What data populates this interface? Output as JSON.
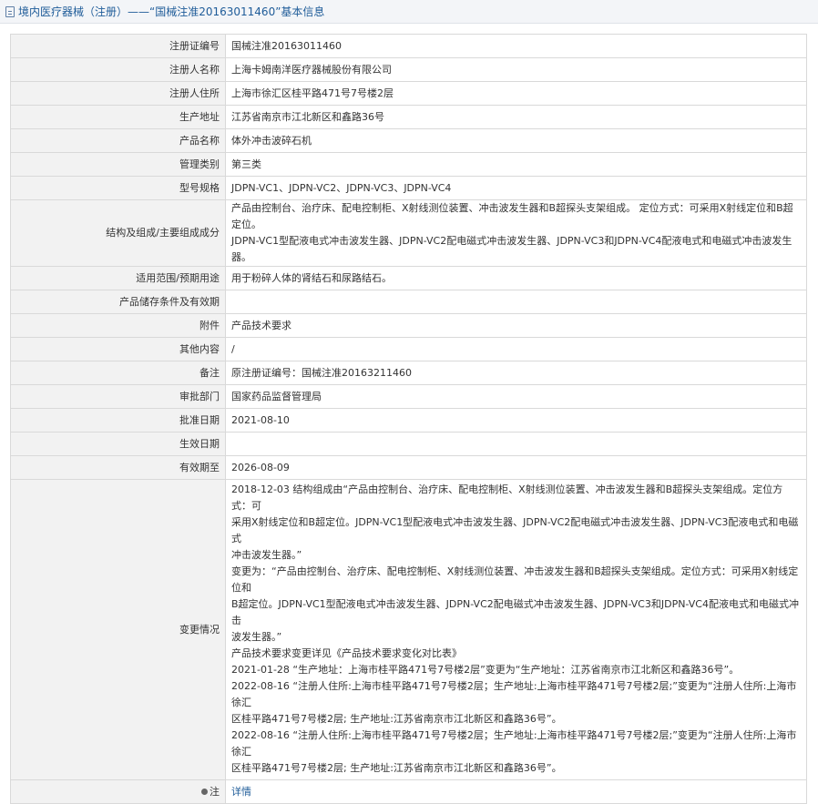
{
  "header": {
    "title": "境内医疗器械（注册）——“国械注准20163011460”基本信息",
    "icon": "document-icon"
  },
  "rows": [
    {
      "label": "注册证编号",
      "value": "国械注准20163011460"
    },
    {
      "label": "注册人名称",
      "value": "上海卡姆南洋医疗器械股份有限公司"
    },
    {
      "label": "注册人住所",
      "value": "上海市徐汇区桂平路471号7号楼2层"
    },
    {
      "label": "生产地址",
      "value": "江苏省南京市江北新区和鑫路36号"
    },
    {
      "label": "产品名称",
      "value": "体外冲击波碎石机"
    },
    {
      "label": "管理类别",
      "value": "第三类"
    },
    {
      "label": "型号规格",
      "value": "JDPN-VC1、JDPN-VC2、JDPN-VC3、JDPN-VC4"
    },
    {
      "label": "结构及组成/主要组成成分",
      "lines": [
        "产品由控制台、治疗床、配电控制柜、X射线测位装置、冲击波发生器和B超探头支架组成。 定位方式：可采用X射线定位和B超定位。",
        "JDPN-VC1型配液电式冲击波发生器、JDPN-VC2配电磁式冲击波发生器、JDPN-VC3和JDPN-VC4配液电式和电磁式冲击波发生器。"
      ]
    },
    {
      "label": "适用范围/预期用途",
      "value": "用于粉碎人体的肾结石和尿路结石。"
    },
    {
      "label": "产品储存条件及有效期",
      "value": ""
    },
    {
      "label": "附件",
      "value": "产品技术要求"
    },
    {
      "label": "其他内容",
      "value": "/"
    },
    {
      "label": "备注",
      "value": "原注册证编号：国械注准20163211460"
    },
    {
      "label": "审批部门",
      "value": "国家药品监督管理局"
    },
    {
      "label": "批准日期",
      "value": "2021-08-10"
    },
    {
      "label": "生效日期",
      "value": ""
    },
    {
      "label": "有效期至",
      "value": "2026-08-09"
    }
  ],
  "changes": {
    "label": "变更情况",
    "lines": [
      "2018-12-03 结构组成由“产品由控制台、治疗床、配电控制柜、X射线测位装置、冲击波发生器和B超探头支架组成。定位方式：可",
      "采用X射线定位和B超定位。JDPN-VC1型配液电式冲击波发生器、JDPN-VC2配电磁式冲击波发生器、JDPN-VC3配液电式和电磁式",
      "冲击波发生器。”",
      "变更为：“产品由控制台、治疗床、配电控制柜、X射线测位装置、冲击波发生器和B超探头支架组成。定位方式：可采用X射线定位和",
      "B超定位。JDPN-VC1型配液电式冲击波发生器、JDPN-VC2配电磁式冲击波发生器、JDPN-VC3和JDPN-VC4配液电式和电磁式冲击",
      "波发生器。”",
      "产品技术要求变更详见《产品技术要求变化对比表》",
      "2021-01-28 “生产地址：上海市桂平路471号7号楼2层”变更为“生产地址：江苏省南京市江北新区和鑫路36号”。",
      "2022-08-16 “注册人住所:上海市桂平路471号7号楼2层；生产地址:上海市桂平路471号7号楼2层;”变更为“注册人住所:上海市徐汇",
      "区桂平路471号7号楼2层; 生产地址:江苏省南京市江北新区和鑫路36号”。",
      "2022-08-16 “注册人住所:上海市桂平路471号7号楼2层；生产地址:上海市桂平路471号7号楼2层;”变更为“注册人住所:上海市徐汇",
      "区桂平路471号7号楼2层; 生产地址:江苏省南京市江北新区和鑫路36号”。"
    ]
  },
  "note": {
    "label": "注",
    "icon": "bullet-icon",
    "link": "详情"
  }
}
